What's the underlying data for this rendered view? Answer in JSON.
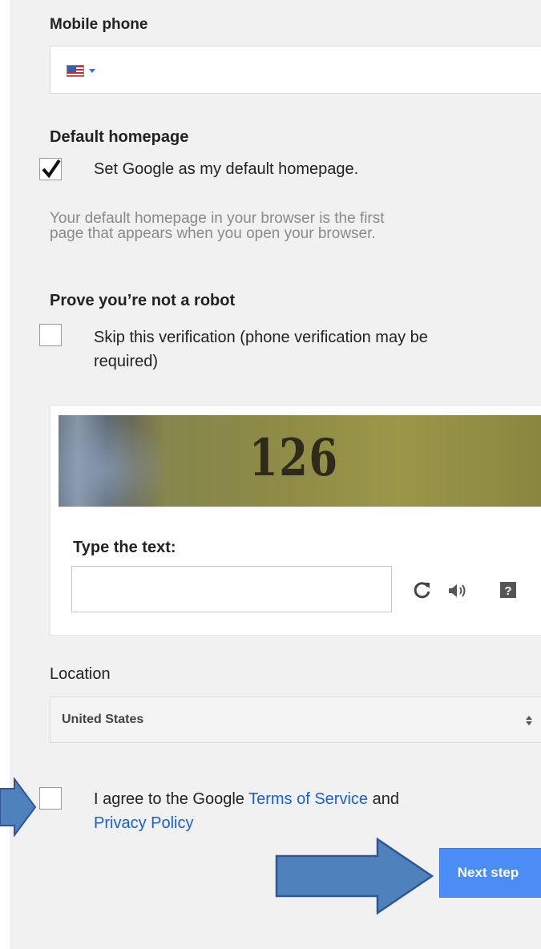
{
  "mobile_phone": {
    "label": "Mobile phone",
    "country_flag": "us-flag-icon"
  },
  "default_homepage": {
    "heading": "Default homepage",
    "checkbox_label": "Set Google as my default homepage.",
    "checked": true,
    "helper_line1": "Your default homepage in your browser is the first",
    "helper_line2": "page that appears when you open your browser."
  },
  "robot": {
    "heading": "Prove you’re not a robot",
    "skip_line1": "Skip this verification (phone verification may be",
    "skip_line2": "required)",
    "checked": false
  },
  "captcha": {
    "image_text": "126",
    "type_label": "Type the text:",
    "input_value": "",
    "icons": [
      "refresh-icon",
      "audio-icon",
      "help-icon"
    ]
  },
  "location": {
    "heading": "Location",
    "selected": "United States"
  },
  "terms": {
    "prefix": "I agree to the Google ",
    "tos_link": "Terms of Service",
    "middle": " and",
    "privacy_link": "Privacy Policy",
    "checked": false
  },
  "next_button": {
    "label": "Next step"
  },
  "colors": {
    "link": "#1a5fd6",
    "button": "#4b8cf5",
    "annotation_arrow": "#4f81bd"
  }
}
